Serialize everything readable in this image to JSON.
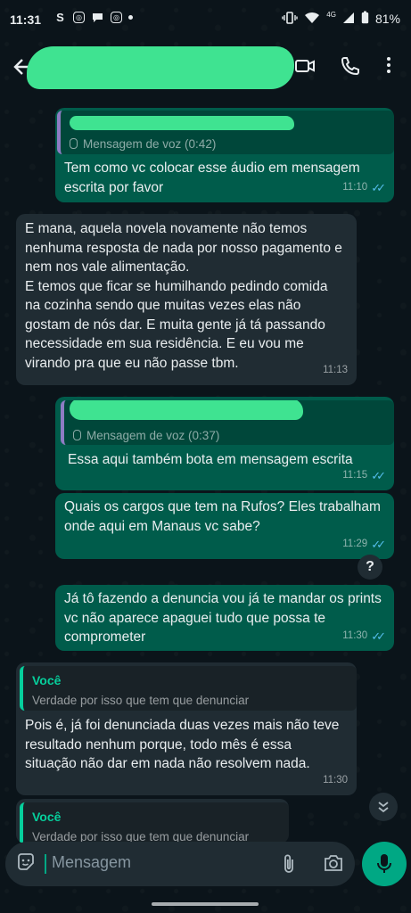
{
  "status_bar": {
    "time": "11:31",
    "app_icon_letter": "S",
    "network": "4G",
    "battery": "81%",
    "icons": [
      "skype-icon",
      "instagram-icon",
      "messages-icon",
      "instagram-icon",
      "wifi-icon",
      "signal-icon",
      "battery-icon"
    ]
  },
  "header": {
    "contact_name_redacted": true,
    "icons": [
      "back-arrow-icon",
      "video-call-icon",
      "phone-icon",
      "more-options-icon"
    ]
  },
  "messages": [
    {
      "direction": "out",
      "reply_to": {
        "redacted_name": true,
        "text": "Mensagem de voz (0:42)"
      },
      "text": "Tem como vc colocar esse áudio em mensagem escrita por favor",
      "time": "11:10",
      "read": true
    },
    {
      "direction": "in",
      "text": "E mana, aquela novela novamente não temos nenhuma resposta de nada por nosso pagamento e nem nos vale alimentação.\nE temos que ficar se humilhando pedindo comida na cozinha sendo que muitas vezes elas não gostam de nós dar. E muita gente já tá passando necessidade em sua residência. E eu vou me virando pra que eu não passe tbm.",
      "time": "11:13"
    },
    {
      "direction": "out",
      "reply_to": {
        "redacted_name": true,
        "text": "Mensagem de voz (0:37)"
      },
      "text": "Essa aqui também bota em mensagem escrita",
      "time": "11:15",
      "read": true
    },
    {
      "direction": "out",
      "text": "Quais os cargos que tem na Rufos? Eles trabalham onde aqui em Manaus vc sabe?",
      "time": "11:29",
      "read": true,
      "badge": "?"
    },
    {
      "direction": "out",
      "text": "Já tô fazendo a denuncia vou já te mandar os prints vc não aparece apaguei tudo que possa te comprometer",
      "time": "11:30",
      "read": true
    },
    {
      "direction": "in",
      "reply_to": {
        "name": "Você",
        "text": "Verdade por isso que tem que denunciar"
      },
      "text": "Pois é, já foi denunciada duas vezes mais não teve resultado nenhum porque, todo mês é essa situação não dar em nada não resolvem nada.",
      "time": "11:30"
    },
    {
      "direction": "in",
      "reply_to": {
        "name": "Você",
        "text": "Verdade por isso que tem que denunciar"
      },
      "partial": true
    }
  ],
  "composer": {
    "placeholder": "Mensagem",
    "icons": [
      "sticker-icon",
      "attach-icon",
      "camera-icon",
      "microphone-icon"
    ]
  },
  "colors": {
    "background": "#0b141a",
    "outgoing_bubble": "#005c4b",
    "incoming_bubble": "#202c33",
    "accent": "#00a884",
    "read_ticks": "#53bdeb",
    "redaction": "#3fe391"
  }
}
